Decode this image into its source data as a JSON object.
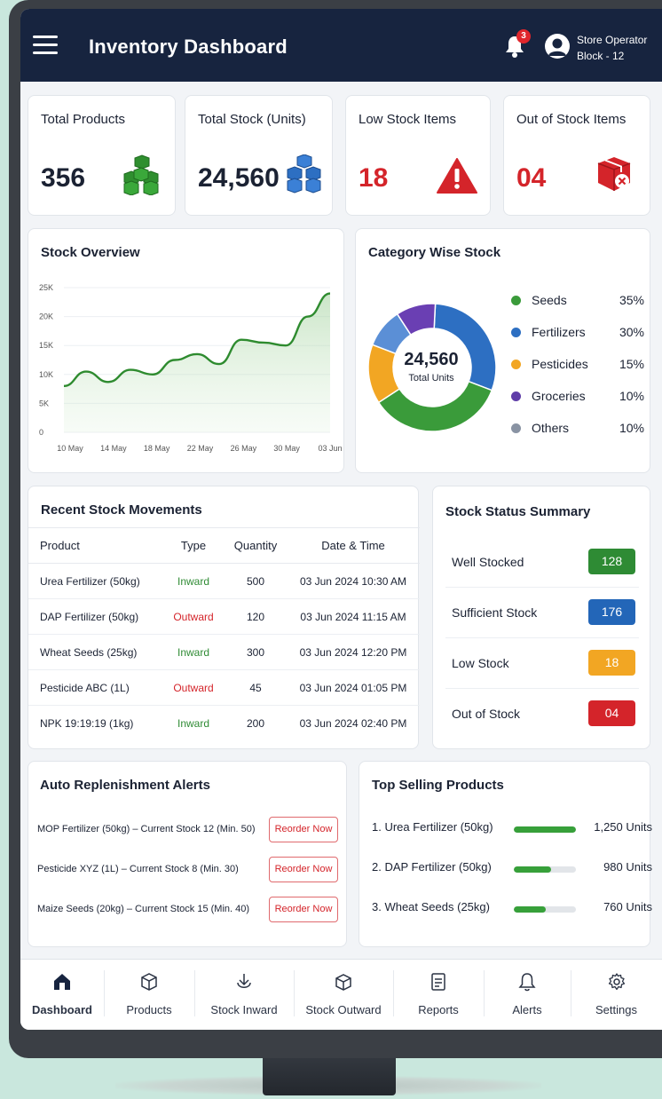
{
  "header": {
    "title": "Inventory Dashboard",
    "notification_count": "3",
    "user_name": "Store Operator",
    "user_block": "Block - 12"
  },
  "kpis": [
    {
      "title": "Total Products",
      "value": "356",
      "color": "#1b2233",
      "icon": "green-boxes-icon"
    },
    {
      "title": "Total Stock (Units)",
      "value": "24,560",
      "color": "#1b2233",
      "icon": "blue-boxes-icon"
    },
    {
      "title": "Low Stock Items",
      "value": "18",
      "color": "#d4242a",
      "icon": "warning-icon"
    },
    {
      "title": "Out of Stock Items",
      "value": "04",
      "color": "#d4242a",
      "icon": "box-x-icon"
    }
  ],
  "stock_overview": {
    "title": "Stock Overview",
    "chart_data": {
      "type": "area",
      "x_tick_labels": [
        "10 May",
        "14 May",
        "18 May",
        "22 May",
        "26 May",
        "30 May",
        "03 Jun"
      ],
      "y_tick_labels": [
        "25K",
        "20K",
        "15K",
        "10K",
        "5K",
        "0"
      ],
      "ylim": [
        0,
        25000
      ],
      "x": [
        "10 May",
        "12 May",
        "14 May",
        "16 May",
        "18 May",
        "20 May",
        "22 May",
        "24 May",
        "26 May",
        "28 May",
        "30 May",
        "01 Jun",
        "03 Jun"
      ],
      "values": [
        8000,
        10500,
        8700,
        10800,
        10000,
        12500,
        13500,
        11800,
        16000,
        15500,
        15000,
        20000,
        24000
      ],
      "line_color": "#2e8b2f"
    }
  },
  "category_stock": {
    "title": "Category Wise Stock",
    "center_value": "24,560",
    "center_label": "Total Units",
    "chart_data": {
      "type": "pie",
      "categories": [
        "Seeds",
        "Fertilizers",
        "Pesticides",
        "Groceries",
        "Others"
      ],
      "values": [
        35,
        30,
        15,
        10,
        10
      ],
      "labels": [
        "35%",
        "30%",
        "15%",
        "10%",
        "10%"
      ],
      "colors": [
        "#3a9b3a",
        "#2d6fc2",
        "#f2a623",
        "#5f3da8",
        "#8993a3"
      ]
    }
  },
  "movements": {
    "title": "Recent Stock Movements",
    "headers": [
      "Product",
      "Type",
      "Quantity",
      "Date & Time"
    ],
    "rows": [
      {
        "product": "Urea Fertilizer (50kg)",
        "type": "Inward",
        "qty": "500",
        "date": "03 Jun 2024 10:30 AM"
      },
      {
        "product": "DAP Fertilizer (50kg)",
        "type": "Outward",
        "qty": "120",
        "date": "03 Jun 2024 11:15 AM"
      },
      {
        "product": "Wheat Seeds (25kg)",
        "type": "Inward",
        "qty": "300",
        "date": "03 Jun 2024 12:20 PM"
      },
      {
        "product": "Pesticide ABC (1L)",
        "type": "Outward",
        "qty": "45",
        "date": "03 Jun 2024 01:05 PM"
      },
      {
        "product": "NPK 19:19:19 (1kg)",
        "type": "Inward",
        "qty": "200",
        "date": "03 Jun 2024 02:40 PM"
      }
    ]
  },
  "status_summary": {
    "title": "Stock Status Summary",
    "rows": [
      {
        "label": "Well Stocked",
        "value": "128",
        "color": "#2e8b34"
      },
      {
        "label": "Sufficient Stock",
        "value": "176",
        "color": "#2366b8"
      },
      {
        "label": "Low Stock",
        "value": "18",
        "color": "#f2a623"
      },
      {
        "label": "Out of Stock",
        "value": "04",
        "color": "#d4242a"
      }
    ]
  },
  "replenishment": {
    "title": "Auto Replenishment Alerts",
    "button_label": "Reorder Now",
    "rows": [
      {
        "text": "MOP Fertilizer (50kg) – Current Stock 12 (Min. 50)"
      },
      {
        "text": "Pesticide XYZ (1L) – Current Stock 8 (Min. 30)"
      },
      {
        "text": "Maize Seeds (20kg) – Current Stock 15 (Min. 40)"
      }
    ]
  },
  "top_selling": {
    "title": "Top Selling Products",
    "rows": [
      {
        "name": "1. Urea Fertilizer (50kg)",
        "units": "1,250 Units",
        "fraction": 1.0
      },
      {
        "name": "2. DAP Fertilizer (50kg)",
        "units": "980 Units",
        "fraction": 0.6
      },
      {
        "name": "3. Wheat Seeds (25kg)",
        "units": "760 Units",
        "fraction": 0.52
      }
    ]
  },
  "nav": [
    {
      "label": "Dashboard",
      "icon": "home-icon",
      "active": true
    },
    {
      "label": "Products",
      "icon": "box-icon"
    },
    {
      "label": "Stock Inward",
      "icon": "arrow-in-icon"
    },
    {
      "label": "Stock Outward",
      "icon": "box-out-icon"
    },
    {
      "label": "Reports",
      "icon": "report-icon"
    },
    {
      "label": "Alerts",
      "icon": "bell-icon"
    },
    {
      "label": "Settings",
      "icon": "gear-icon"
    }
  ]
}
